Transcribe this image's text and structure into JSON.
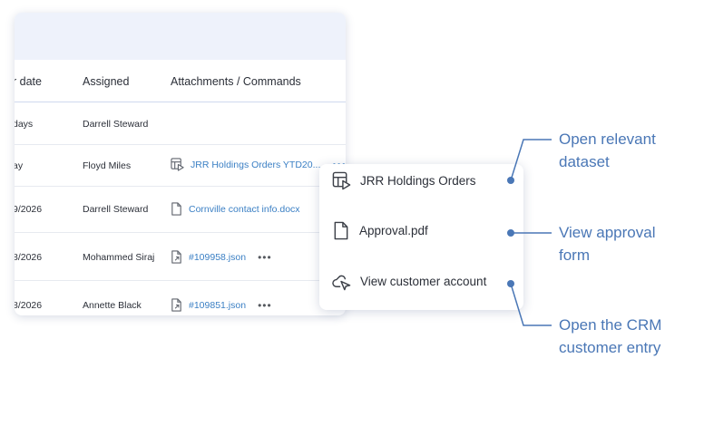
{
  "table": {
    "columns": [
      "r date",
      "Assigned",
      "Attachments / Commands"
    ],
    "rows": [
      {
        "date": "days",
        "assigned": "Darrell Steward",
        "attachment": "",
        "icon": "none",
        "more": false
      },
      {
        "date": "ay",
        "assigned": "Floyd Miles",
        "attachment": "JRR Holdings Orders YTD20...",
        "icon": "dataset-icon",
        "more": true
      },
      {
        "date": "9/2026",
        "assigned": "Darrell Steward",
        "attachment": "Cornville contact info.docx",
        "icon": "file-icon",
        "more": false
      },
      {
        "date": "8/2026",
        "assigned": "Mohammed Siraj",
        "attachment": "#109958.json",
        "icon": "file-link-icon",
        "more": true
      },
      {
        "date": "8/2026",
        "assigned": "Annette Black",
        "attachment": "#109851.json",
        "icon": "file-link-icon",
        "more": true
      }
    ],
    "more_symbol": "•••"
  },
  "menu": {
    "items": [
      {
        "label": "JRR Holdings Orders",
        "icon": "dataset-icon"
      },
      {
        "label": "Approval.pdf",
        "icon": "file-icon"
      },
      {
        "label": "View customer account",
        "icon": "customer-link-icon"
      }
    ]
  },
  "annotations": {
    "dataset": [
      "Open relevant",
      "dataset"
    ],
    "approval": [
      "View approval",
      "form"
    ],
    "crm": [
      "Open the CRM",
      "customer entry"
    ]
  },
  "colors": {
    "accent": "#3a7fc4",
    "annotation": "#4a77b6",
    "header_bg": "#eef2fb"
  }
}
